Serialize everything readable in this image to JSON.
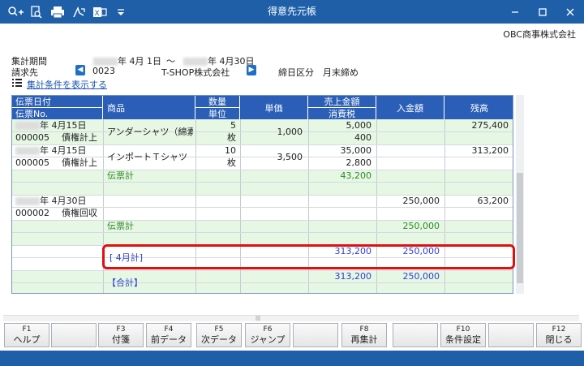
{
  "window": {
    "title": "得意先元帳",
    "company": "OBC商事株式会社"
  },
  "toolbar": {
    "icons": [
      "search-plus-icon",
      "search-doc-icon",
      "print-icon",
      "pdf-export-icon",
      "excel-export-icon",
      "dropdown-arrow-icon"
    ]
  },
  "header": {
    "period_label": "集計期間",
    "period_from": "年 4月 1日",
    "period_sep": "～",
    "period_to": "年 4月30日",
    "customer_label": "請求先",
    "customer_code": "0023",
    "customer_name": "T-SHOP株式会社",
    "closing_label": "締日区分",
    "closing_value": "月末締め",
    "show_conditions": "集計条件を表示する"
  },
  "columns": {
    "date": "伝票日付",
    "no": "伝票No.",
    "item": "商品",
    "qty": "数量",
    "unit": "単位",
    "price": "単価",
    "sales": "売上金額",
    "tax": "消費税",
    "receipt": "入金額",
    "balance": "残高"
  },
  "rows": {
    "r1": {
      "date": "年 4月15日",
      "no": "000005",
      "type": "債権計上",
      "item": "アンダーシャツ（綿素材",
      "qty": "5",
      "unit": "枚",
      "price": "1,000",
      "sales": "5,000",
      "tax": "400",
      "balance": "275,400"
    },
    "r2": {
      "date": "年 4月15日",
      "no": "000005",
      "type": "債権計上",
      "item": "インポートＴシャツ（Ｓ",
      "qty": "10",
      "unit": "枚",
      "price": "3,500",
      "sales": "35,000",
      "tax": "2,800",
      "balance": "313,200"
    },
    "sub1": {
      "label": "伝票計",
      "sales": "43,200"
    },
    "r3": {
      "date": "年 4月30日",
      "no": "000002",
      "type": "債権回収",
      "receipt": "250,000",
      "balance": "63,200"
    },
    "sub2": {
      "label": "伝票計",
      "receipt": "250,000"
    },
    "month": {
      "label": "[ 4月計]",
      "sales": "313,200",
      "receipt": "250,000"
    },
    "total": {
      "label": "【合計】",
      "sales": "313,200",
      "receipt": "250,000"
    }
  },
  "fkeys": [
    {
      "key": "F1",
      "label": "ヘルプ"
    },
    {
      "key": "",
      "label": ""
    },
    {
      "key": "F3",
      "label": "付箋"
    },
    {
      "key": "F4",
      "label": "前データ"
    },
    {
      "key": "F5",
      "label": "次データ"
    },
    {
      "key": "F6",
      "label": "ジャンプ"
    },
    {
      "key": "",
      "label": ""
    },
    {
      "key": "F8",
      "label": "再集計"
    },
    {
      "key": "",
      "label": ""
    },
    {
      "key": "F10",
      "label": "条件設定"
    },
    {
      "key": "",
      "label": ""
    },
    {
      "key": "F12",
      "label": "閉じる"
    }
  ],
  "colors": {
    "titlebar": "#1e5fa8",
    "grid_header": "#2b5fb7",
    "subtotal_text": "#2f8a28",
    "total_text": "#2f3fd0",
    "highlight": "#e01010"
  }
}
